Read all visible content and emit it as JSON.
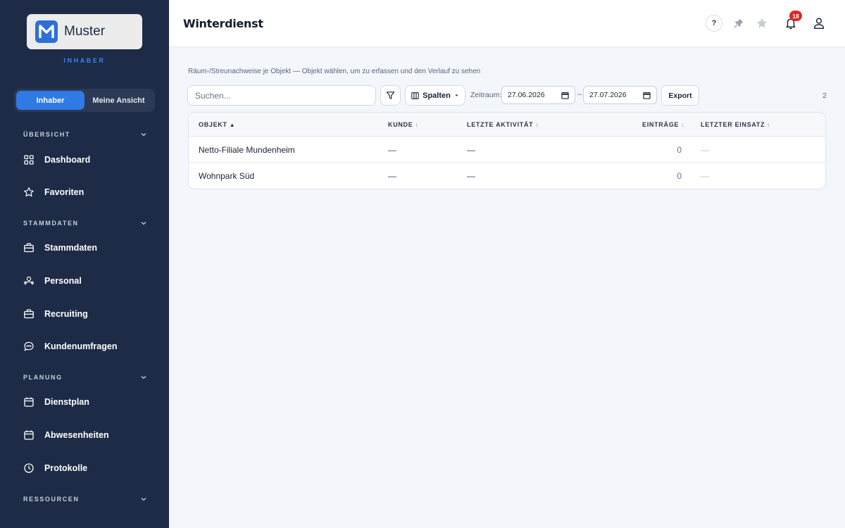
{
  "sidebar": {
    "logo_text": "Muster",
    "role_label": "INHABER",
    "view_switch": [
      "Inhaber",
      "Meine Ansicht"
    ],
    "sections": {
      "overview": "ÜBERSICHT",
      "master": "STAMMDATEN",
      "planning": "PLANUNG",
      "resources": "RESSOURCEN"
    },
    "items": {
      "dashboard": "Dashboard",
      "favorites": "Favoriten",
      "stammdaten": "Stammdaten",
      "personal": "Personal",
      "recruiting": "Recruiting",
      "surveys": "Kundenumfragen",
      "dienstplan": "Dienstplan",
      "absences": "Abwesenheiten",
      "protocols": "Protokolle"
    }
  },
  "header": {
    "title": "Winterdienst",
    "help": "?",
    "notification_count": "18"
  },
  "main": {
    "subtitle": "Räum-/Streunachweise je Objekt — Objekt wählen, um zu erfassen und den Verlauf zu sehen",
    "search_placeholder": "Suchen...",
    "columns_button": "Spalten",
    "range_label": "Zeitraum:",
    "date_from": "27.06.2026",
    "date_separator": "–",
    "date_to": "27.07.2026",
    "export_button": "Export",
    "result_count": "2"
  },
  "table": {
    "headers": {
      "object": "OBJEKT",
      "customer": "KUNDE",
      "last_activity": "LETZTE AKTIVITÄT",
      "entries": "EINTRÄGE",
      "last_deployment": "LETZTER EINSATZ"
    },
    "rows": [
      {
        "object": "Netto-Filiale Mundenheim",
        "customer": "—",
        "last_activity": "—",
        "entries": "0",
        "last_deployment": "—"
      },
      {
        "object": "Wohnpark Süd",
        "customer": "—",
        "last_activity": "—",
        "entries": "0",
        "last_deployment": "—"
      }
    ]
  },
  "colors": {
    "sidebar_bg": "#1d2b46",
    "accent": "#2f7ae5",
    "badge": "#d92a2a"
  },
  "icons": [
    "logo-m-icon",
    "grid-icon",
    "star-icon",
    "briefcase-icon",
    "users-icon",
    "chat-icon",
    "calendar-icon",
    "clock-icon",
    "chevron-down-icon",
    "help-icon",
    "pin-icon",
    "bell-icon",
    "user-icon",
    "filter-icon",
    "columns-icon",
    "caret-down-icon",
    "calendar-picker-icon",
    "sort-icon"
  ]
}
